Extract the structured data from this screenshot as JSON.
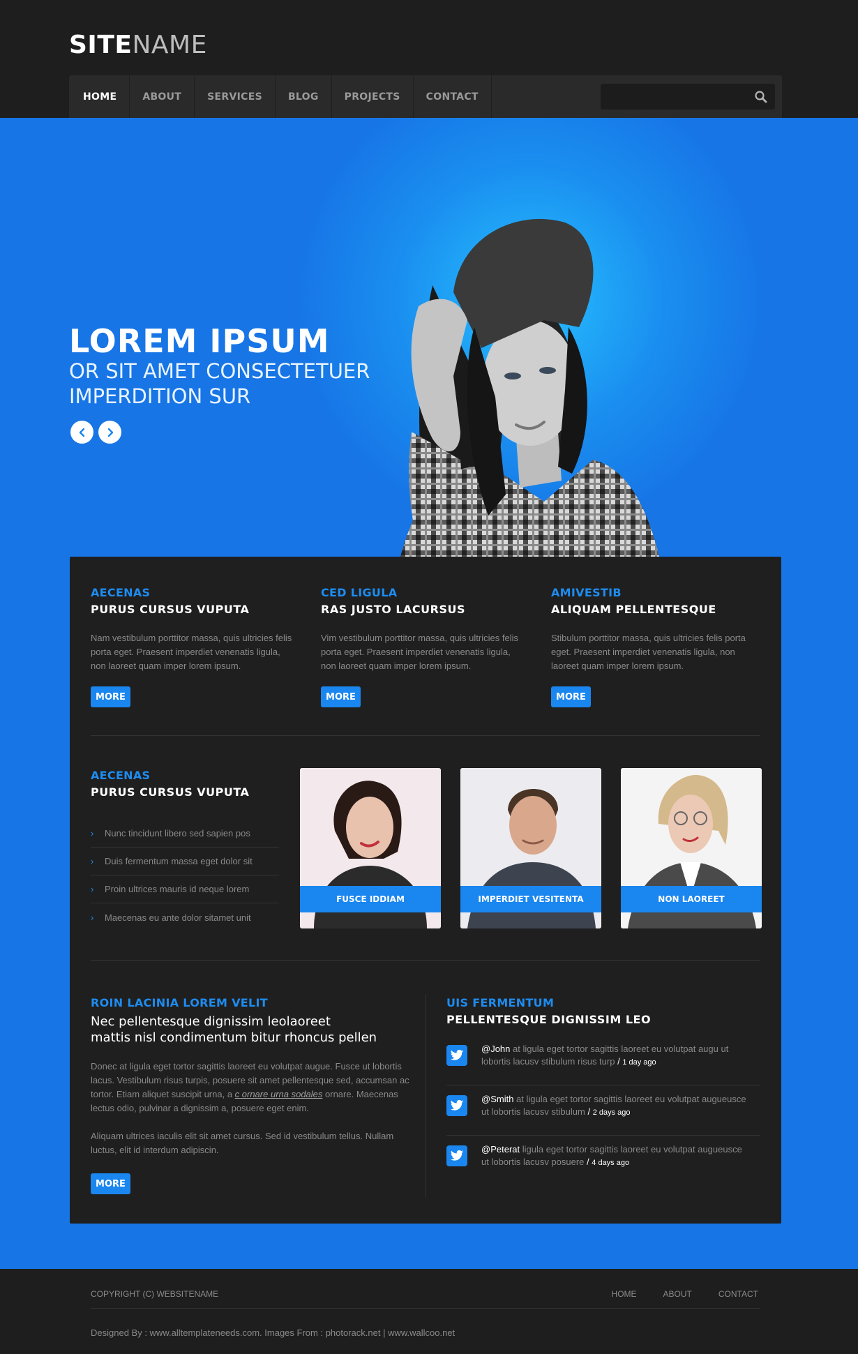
{
  "site": {
    "logo_bold": "SITE",
    "logo_light": "NAME"
  },
  "nav": {
    "items": [
      {
        "label": "HOME"
      },
      {
        "label": "ABOUT"
      },
      {
        "label": "SERVICES"
      },
      {
        "label": "BLOG"
      },
      {
        "label": "PROJECTS"
      },
      {
        "label": "CONTACT"
      }
    ],
    "search_placeholder": ""
  },
  "hero": {
    "title": "LOREM IPSUM",
    "subtitle_line1": "OR SIT AMET CONSECTETUER",
    "subtitle_line2": "IMPERDITION SUR"
  },
  "columns": [
    {
      "kicker": "AECENAS",
      "heading": "PURUS CURSUS VUPUTA",
      "text": "Nam vestibulum porttitor massa, quis ultricies felis porta eget. Praesent imperdiet venenatis ligula, non laoreet quam imper lorem ipsum.",
      "button": "MORE"
    },
    {
      "kicker": "CED LIGULA",
      "heading": "RAS JUSTO LACURSUS",
      "text": "Vim vestibulum porttitor massa, quis ultricies felis porta eget. Praesent imperdiet venenatis ligula, non laoreet quam imper lorem ipsum.",
      "button": "MORE"
    },
    {
      "kicker": "AMIVESTIB",
      "heading": "ALIQUAM PELLENTESQUE",
      "text": "Stibulum porttitor massa, quis ultricies felis porta eget. Praesent imperdiet venenatis ligula, non laoreet quam imper lorem ipsum.",
      "button": "MORE"
    }
  ],
  "list_block": {
    "kicker": "AECENAS",
    "heading": "PURUS CURSUS VUPUTA",
    "items": [
      "Nunc tincidunt libero sed sapien pos",
      "Duis fermentum massa eget dolor sit",
      "Proin ultrices mauris id neque lorem",
      "Maecenas eu ante dolor sitamet unit"
    ]
  },
  "team": [
    {
      "label": "FUSCE IDDIAM"
    },
    {
      "label": "IMPERDIET VESITENTA"
    },
    {
      "label": "NON LAOREET"
    }
  ],
  "about": {
    "kicker": "ROIN LACINIA LOREM VELIT",
    "lead_line1": "Nec pellentesque dignissim leolaoreet",
    "lead_line2": "mattis nisl condimentum bitur rhoncus pellen",
    "p1_before": "Donec at ligula eget tortor sagittis laoreet eu volutpat augue. Fusce ut lobortis lacus. Vestibulum risus turpis, posuere sit amet pellentesque sed, accumsan ac tortor. Etiam aliquet suscipit urna, a ",
    "p1_link": "c ornare urna sodales",
    "p1_after": " ornare. Maecenas lectus odio, pulvinar a dignissim a, posuere eget enim.",
    "p2": "Aliquam ultrices iaculis elit sit amet cursus. Sed id vestibulum tellus. Nullam luctus, elit id interdum adipiscin.",
    "button": "MORE"
  },
  "tweets_block": {
    "kicker": "UIS FERMENTUM",
    "heading": "PELLENTESQUE DIGNISSIM LEO",
    "tweets": [
      {
        "handle": "@John",
        "text": " at ligula eget tortor sagittis laoreet eu volutpat augu ut lobortis lacusv stibulum risus turp",
        "sep": " / ",
        "time": "1 day ago"
      },
      {
        "handle": "@Smith",
        "text": " at ligula eget tortor sagittis laoreet eu volutpat augueusce ut lobortis lacusv stibulum",
        "sep": " / ",
        "time": "2 days ago"
      },
      {
        "handle": "@Peterat",
        "text": " ligula eget tortor sagittis laoreet eu volutpat augueusce ut lobortis lacusv  posuere",
        "sep": " / ",
        "time": "4 days ago"
      }
    ]
  },
  "footer": {
    "copyright": "COPYRIGHT (C) WEBSITENAME",
    "links": [
      "HOME",
      "ABOUT",
      "CONTACT"
    ],
    "credits": "Designed By : www.alltemplateneeds.com. Images  From : photorack.net | www.wallcoo.net"
  },
  "colors": {
    "accent": "#1a86f0",
    "hero_blue": "#1775e6",
    "dark": "#1f1f1f"
  }
}
